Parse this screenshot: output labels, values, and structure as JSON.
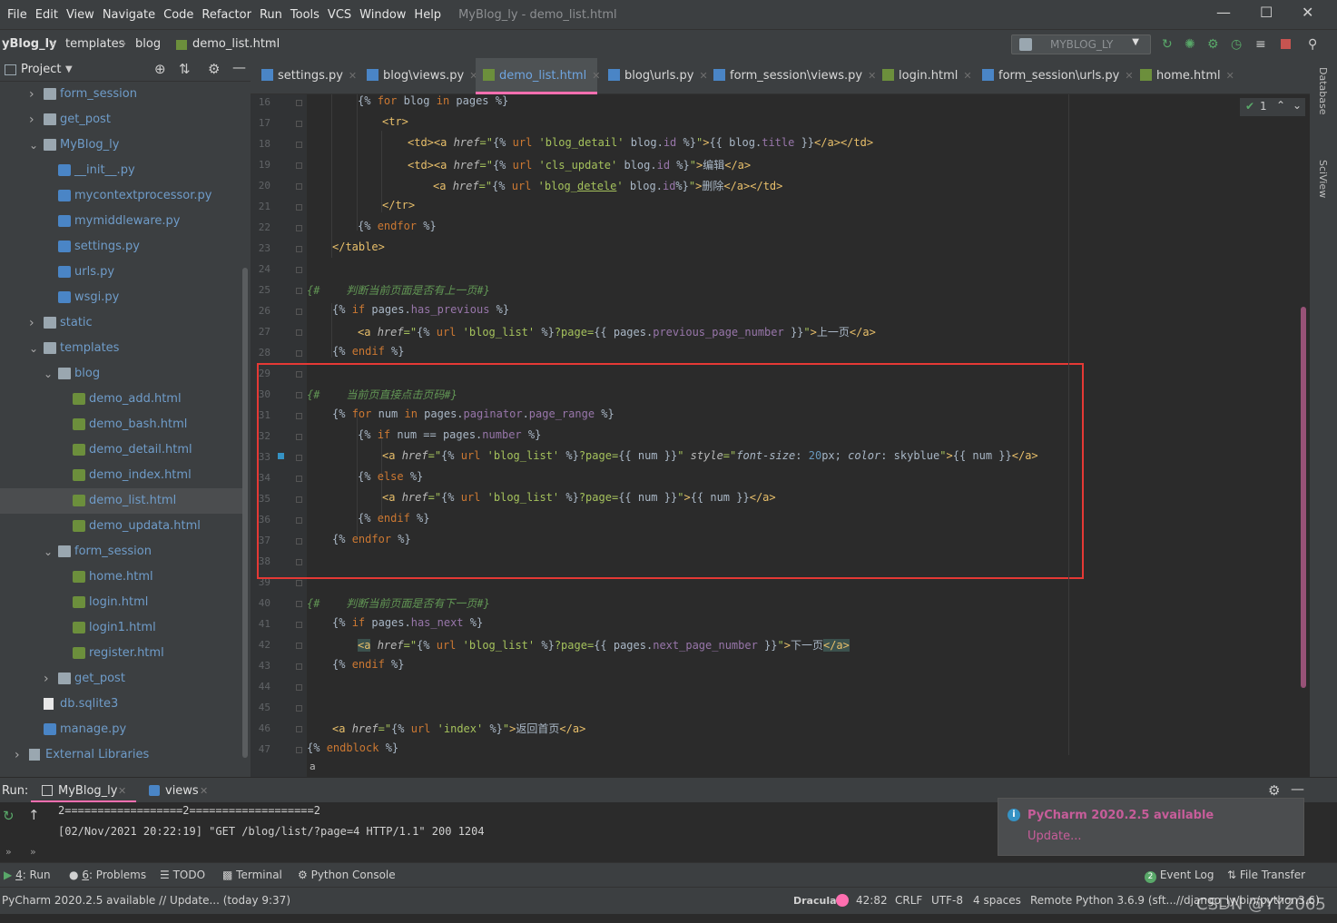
{
  "menu": {
    "items": [
      "File",
      "Edit",
      "View",
      "Navigate",
      "Code",
      "Refactor",
      "Run",
      "Tools",
      "VCS",
      "Window",
      "Help"
    ],
    "window_title": "MyBlog_ly - demo_list.html"
  },
  "breadcrumb": [
    "yBlog_ly",
    "templates",
    "blog",
    "demo_list.html"
  ],
  "run_config": "MYBLOG_LY",
  "project_panel": {
    "title": "Project",
    "tree": [
      {
        "label": "form_session",
        "kind": "folder",
        "depth": 1,
        "expanded": false
      },
      {
        "label": "get_post",
        "kind": "folder",
        "depth": 1,
        "expanded": false
      },
      {
        "label": "MyBlog_ly",
        "kind": "folder",
        "depth": 1,
        "expanded": true
      },
      {
        "label": "__init__.py",
        "kind": "py",
        "depth": 2
      },
      {
        "label": "mycontextprocessor.py",
        "kind": "py",
        "depth": 2
      },
      {
        "label": "mymiddleware.py",
        "kind": "py",
        "depth": 2
      },
      {
        "label": "settings.py",
        "kind": "py",
        "depth": 2
      },
      {
        "label": "urls.py",
        "kind": "py",
        "depth": 2
      },
      {
        "label": "wsgi.py",
        "kind": "py",
        "depth": 2
      },
      {
        "label": "static",
        "kind": "folder",
        "depth": 1,
        "expanded": false
      },
      {
        "label": "templates",
        "kind": "folder",
        "depth": 1,
        "expanded": true
      },
      {
        "label": "blog",
        "kind": "folder",
        "depth": 2,
        "expanded": true
      },
      {
        "label": "demo_add.html",
        "kind": "html",
        "depth": 3
      },
      {
        "label": "demo_bash.html",
        "kind": "html",
        "depth": 3
      },
      {
        "label": "demo_detail.html",
        "kind": "html",
        "depth": 3
      },
      {
        "label": "demo_index.html",
        "kind": "html",
        "depth": 3
      },
      {
        "label": "demo_list.html",
        "kind": "html",
        "depth": 3,
        "selected": true
      },
      {
        "label": "demo_updata.html",
        "kind": "html",
        "depth": 3
      },
      {
        "label": "form_session",
        "kind": "folder",
        "depth": 2,
        "expanded": true
      },
      {
        "label": "home.html",
        "kind": "html",
        "depth": 3
      },
      {
        "label": "login.html",
        "kind": "html",
        "depth": 3
      },
      {
        "label": "login1.html",
        "kind": "html",
        "depth": 3
      },
      {
        "label": "register.html",
        "kind": "html",
        "depth": 3
      },
      {
        "label": "get_post",
        "kind": "folder",
        "depth": 2,
        "expanded": false
      },
      {
        "label": "db.sqlite3",
        "kind": "db",
        "depth": 1
      },
      {
        "label": "manage.py",
        "kind": "py",
        "depth": 1
      },
      {
        "label": "External Libraries",
        "kind": "lib",
        "depth": 0,
        "expanded": false
      }
    ]
  },
  "tabs": [
    {
      "label": "settings.py",
      "kind": "py"
    },
    {
      "label": "blog\\views.py",
      "kind": "py"
    },
    {
      "label": "demo_list.html",
      "kind": "html",
      "active": true
    },
    {
      "label": "blog\\urls.py",
      "kind": "py"
    },
    {
      "label": "form_session\\views.py",
      "kind": "py"
    },
    {
      "label": "login.html",
      "kind": "html"
    },
    {
      "label": "form_session\\urls.py",
      "kind": "py"
    },
    {
      "label": "home.html",
      "kind": "html"
    }
  ],
  "inspection": "1",
  "editor": {
    "line_numbers": [
      "16",
      "17",
      "18",
      "19",
      "20",
      "21",
      "22",
      "23",
      "24",
      "25",
      "26",
      "27",
      "28",
      "29",
      "30",
      "31",
      "32",
      "33",
      "34",
      "35",
      "36",
      "37",
      "38",
      "39",
      "40",
      "41",
      "42",
      "43",
      "44",
      "45",
      "46",
      "47"
    ],
    "breadcrumb_bottom": "a",
    "comments": {
      "prev_page": "{#    判断当前页面是否有上一页#}",
      "page_range": "{#    当前页直接点击页码#}",
      "next_page": "{#    判断当前页面是否有下一页#}"
    },
    "labels": {
      "edit": "编辑",
      "delete": "删除",
      "prev": "上一页",
      "next": "下一页",
      "home": "返回首页"
    }
  },
  "right_strip": [
    "Database",
    "SciView"
  ],
  "run_panel": {
    "label": "Run:",
    "tabs": [
      "MyBlog_ly",
      "views"
    ],
    "output": [
      "2==================2===================2",
      "[02/Nov/2021 20:22:19] \"GET /blog/list/?page=4 HTTP/1.1\" 200 1204"
    ]
  },
  "notification": {
    "title": "PyCharm 2020.2.5 available",
    "link": "Update..."
  },
  "tool_windows": {
    "left": [
      {
        "num": "4",
        "label": ": Run"
      },
      {
        "num": "6",
        "label": ": Problems"
      },
      {
        "num": "",
        "label": "TODO"
      },
      {
        "num": "",
        "label": "Terminal"
      },
      {
        "num": "",
        "label": "Python Console"
      }
    ],
    "right": [
      "Event Log",
      "File Transfer"
    ],
    "event_badge": "2"
  },
  "status_bar": {
    "message": "PyCharm 2020.2.5 available // Update... (today 9:37)",
    "theme": "Dracula",
    "position": "42:82",
    "line_sep": "CRLF",
    "encoding": "UTF-8",
    "indent": "4 spaces",
    "interpreter": "Remote Python 3.6.9 (sft...//django_ly/bin/python3.6)"
  },
  "watermark": "CSDN @YY2065",
  "colors": {
    "accent_tab": "#ff6fb0",
    "highlight_box": "#e53935",
    "keyword": "#cc7832",
    "tag": "#e8bf6a",
    "string": "#a5c25c"
  }
}
